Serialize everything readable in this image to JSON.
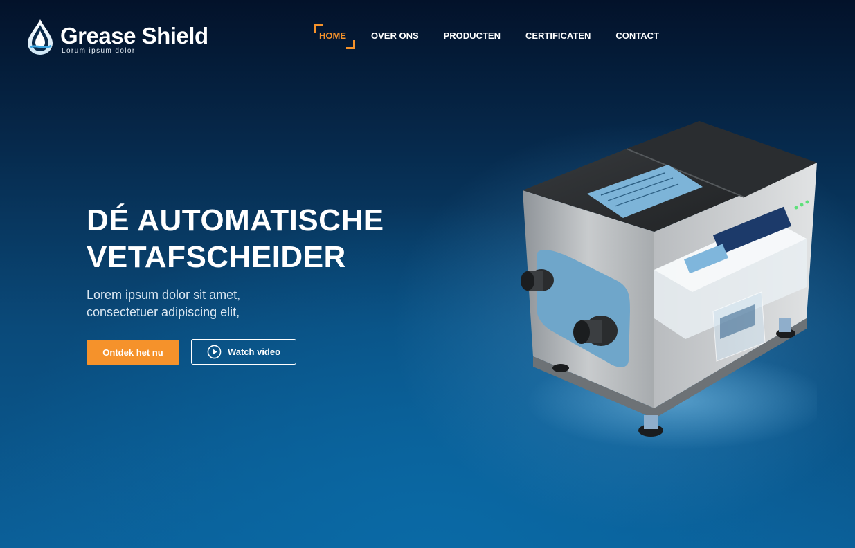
{
  "brand": {
    "name": "Grease Shield",
    "tagline": "Lorum ipsum dolor"
  },
  "nav": {
    "items": [
      {
        "label": "HOME",
        "active": true
      },
      {
        "label": "OVER ONS",
        "active": false
      },
      {
        "label": "PRODUCTEN",
        "active": false
      },
      {
        "label": "CERTIFICATEN",
        "active": false
      },
      {
        "label": "CONTACT",
        "active": false
      }
    ]
  },
  "hero": {
    "title_line1": "DÉ AUTOMATISCHE",
    "title_line2": "VETAFSCHEIDER",
    "subtitle_line1": "Lorem ipsum dolor sit amet,",
    "subtitle_line2": "consectetuer adipiscing elit,",
    "primary_button": "Ontdek het nu",
    "secondary_button": "Watch video"
  },
  "icons": {
    "logo": "water-drop-icon",
    "play": "play-icon"
  },
  "colors": {
    "accent": "#f5922b",
    "background_dark": "#03122a",
    "background_light": "#0b5f98",
    "text": "#ffffff"
  }
}
